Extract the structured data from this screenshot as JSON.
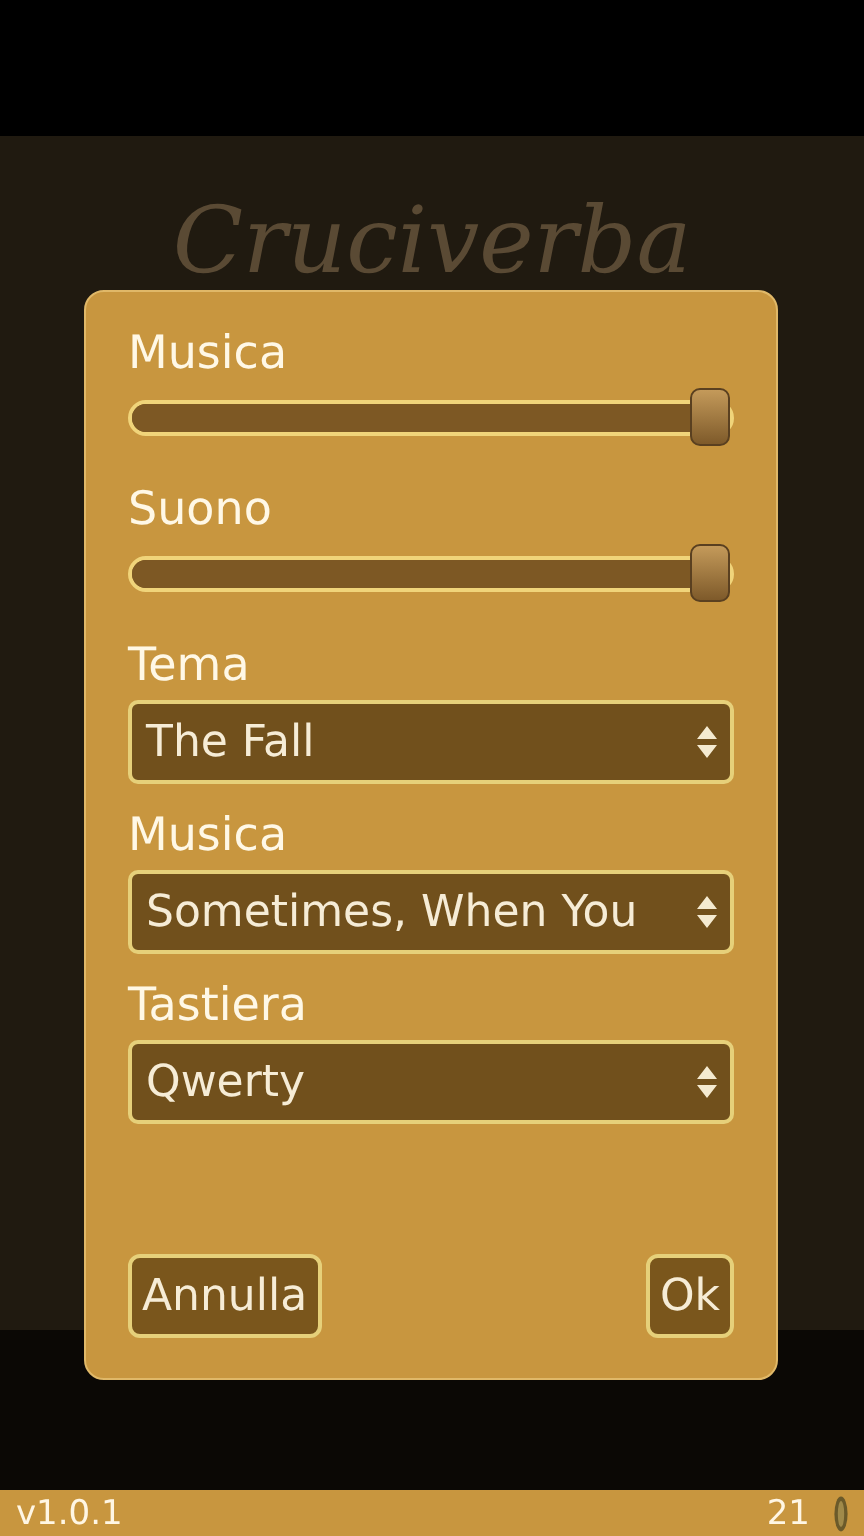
{
  "background": {
    "title": "Cruciverba"
  },
  "dialog": {
    "sliders": [
      {
        "label": "Musica",
        "level": 1
      },
      {
        "label": "Suono",
        "level": 1
      }
    ],
    "selects": [
      {
        "label": "Tema",
        "value": "The Fall"
      },
      {
        "label": "Musica",
        "value": "Sometimes, When You"
      },
      {
        "label": "Tastiera",
        "value": "Qwerty"
      }
    ],
    "buttons": [
      {
        "label": "Annulla"
      },
      {
        "label": "Ok"
      }
    ]
  },
  "status_bar": {
    "version": "v1.0.1",
    "coins": "21"
  }
}
